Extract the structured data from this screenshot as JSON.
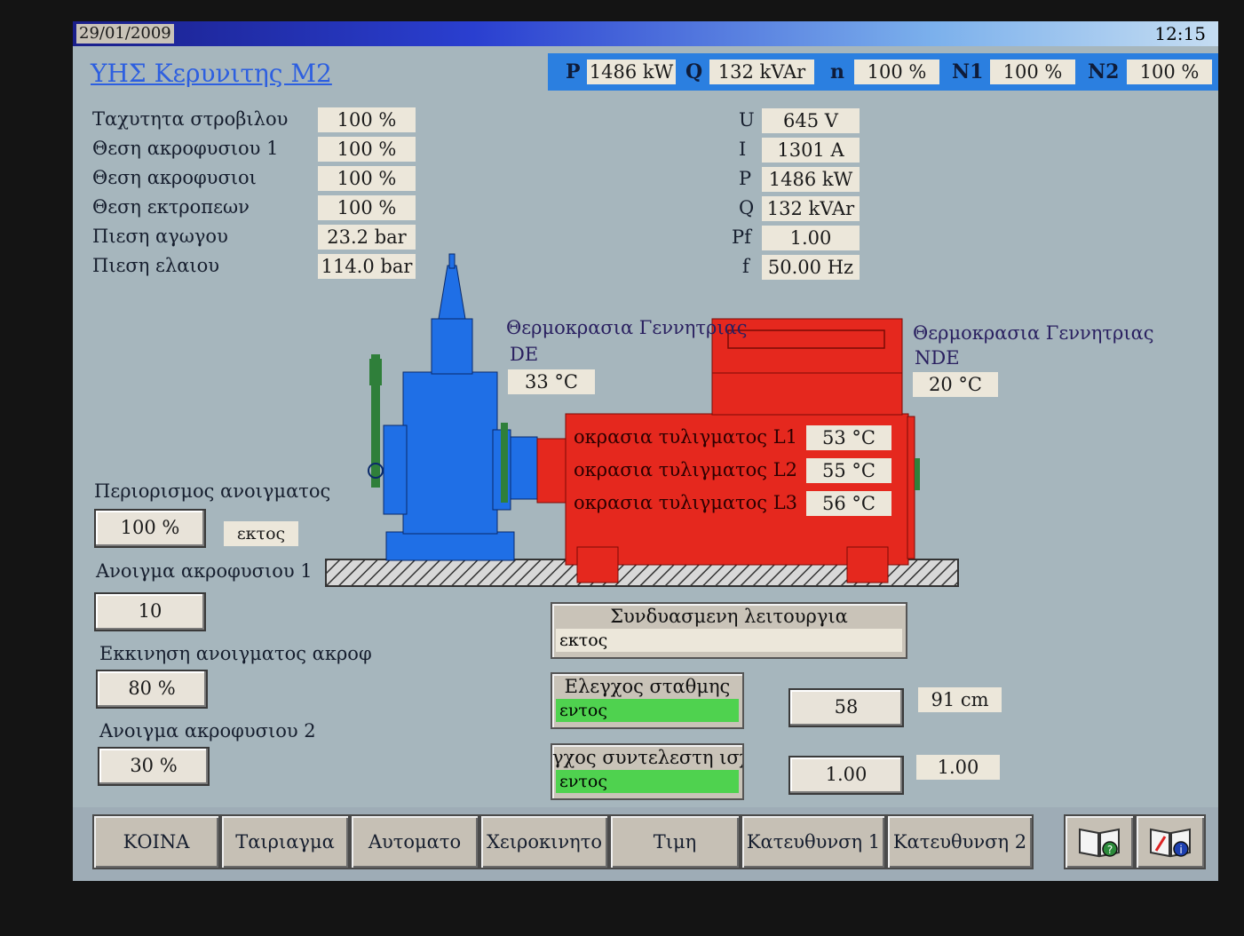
{
  "window": {
    "date": "29/01/2009",
    "time": "12:15",
    "station_title": "ΥΗΣ Κερυνιτης Μ2"
  },
  "top_strip": [
    {
      "label": "P",
      "value": "1486 kW"
    },
    {
      "label": "Q",
      "value": "132 kVAr"
    },
    {
      "label": "n",
      "value": "100 %"
    },
    {
      "label": "N1",
      "value": "100 %"
    },
    {
      "label": "N2",
      "value": "100 %"
    }
  ],
  "turbine_params": [
    {
      "label": "Ταχυτητα στροβιλου",
      "value": "100 %"
    },
    {
      "label": "Θεση ακροφυσιου 1",
      "value": "100 %"
    },
    {
      "label": "Θεση ακροφυσιοι",
      "value": "100 %"
    },
    {
      "label": "Θεση εκτροπεων",
      "value": "100 %"
    },
    {
      "label": "Πιεση αγωγου",
      "value": "23.2 bar"
    },
    {
      "label": "Πιεση ελαιου",
      "value": "114.0 bar"
    }
  ],
  "electrical": [
    {
      "label": "U",
      "value": "645 V"
    },
    {
      "label": "I",
      "value": "1301 A"
    },
    {
      "label": "P",
      "value": "1486 kW"
    },
    {
      "label": "Q",
      "value": "132 kVAr"
    },
    {
      "label": "Pf",
      "value": "1.00"
    },
    {
      "label": "f",
      "value": "50.00 Hz"
    }
  ],
  "gen_temp_de": {
    "label": "Θερμοκρασια Γεννητριας",
    "sub": "DE",
    "value": "33 °C"
  },
  "gen_temp_nde": {
    "label": "Θερμοκρασια Γεννητριας",
    "sub": "NDE",
    "value": "20 °C"
  },
  "windings": [
    {
      "label": "οκρασια τυλιγματος L1",
      "value": "53 °C"
    },
    {
      "label": "οκρασια τυλιγματος L2",
      "value": "55 °C"
    },
    {
      "label": "οκρασια τυλιγματος L3",
      "value": "56 °C"
    }
  ],
  "controls": {
    "opening_limit": {
      "label": "Περιορισμος ανοιγματος",
      "value": "100 %",
      "status": "εκτος"
    },
    "nozzle1_open": {
      "label": "Ανοιγμα ακροφυσιου 1",
      "value": "10"
    },
    "start_opening": {
      "label": "Εκκινηση ανοιγματος ακροφ",
      "value": "80 %"
    },
    "nozzle2_open": {
      "label": "Ανοιγμα ακροφυσιου 2",
      "value": "30 %"
    }
  },
  "combined_operation": {
    "title": "Συνδυασμενη λειτουργια",
    "status": "εκτος"
  },
  "level_control": {
    "title": "Ελεγχος σταθμης",
    "status": "εντος",
    "setpoint": "58",
    "reading": "91 cm"
  },
  "pf_control": {
    "title": "γχος συντελεστη ισχ",
    "status": "εντος",
    "setpoint": "1.00",
    "reading": "1.00"
  },
  "tabs": [
    "ΚΟΙΝΑ",
    "Ταιριαγμα",
    "Αυτοματο",
    "Χειροκινητο",
    "Τιμη",
    "Κατευθυνση 1",
    "Κατευθυνση 2"
  ],
  "colors": {
    "turbine": "#1f6fe6",
    "generator": "#e5281e",
    "status_on": "#4fd24f"
  }
}
